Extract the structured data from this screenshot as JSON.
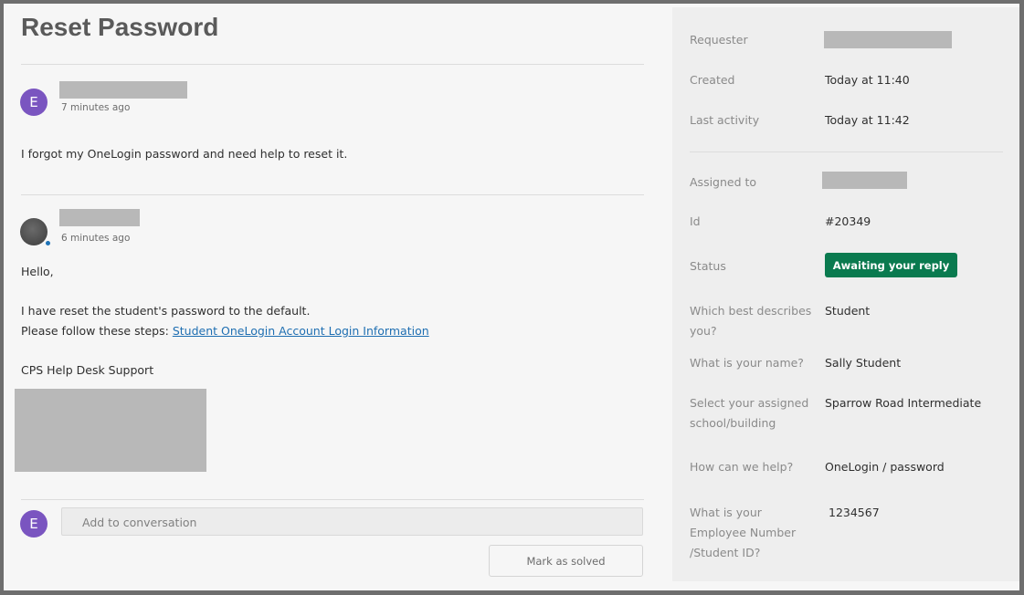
{
  "ticket": {
    "title": "Reset Password"
  },
  "conversation": [
    {
      "avatar_letter": "E",
      "time": "7 minutes ago",
      "lines": [
        "I forgot my OneLogin password and need help to reset it."
      ]
    },
    {
      "time": "6 minutes ago",
      "greeting": "Hello,",
      "line1": "I have reset the student's password to the default.",
      "line2_prefix": "Please follow these steps: ",
      "link_text": "Student OneLogin Account Login Information",
      "signature": "CPS Help Desk Support"
    }
  ],
  "composer": {
    "avatar_letter": "E",
    "placeholder": "Add to conversation",
    "solve_label": "Mark as solved"
  },
  "sidebar": {
    "requester_label": "Requester",
    "created_label": "Created",
    "created_value": "Today at 11:40",
    "last_activity_label": "Last activity",
    "last_activity_value": "Today at 11:42",
    "assigned_label": "Assigned to",
    "id_label": "Id",
    "id_value": "#20349",
    "status_label": "Status",
    "status_value": "Awaiting your reply",
    "status_color": "#0a7a4f",
    "describes_label_1": "Which best describes",
    "describes_label_2": "you?",
    "describes_value": "Student",
    "name_label": "What is your name?",
    "name_value": "Sally Student",
    "school_label_1": "Select your assigned",
    "school_label_2": "school/building",
    "school_value": "Sparrow Road Intermediate",
    "help_label": "How can we help?",
    "help_value": "OneLogin / password",
    "empno_label_1": "What is your",
    "empno_label_2": "Employee Number",
    "empno_label_3": "/Student ID?",
    "empno_value": "1234567"
  },
  "colors": {
    "accent_avatar": "#7a55c0",
    "link": "#1f6fb2"
  }
}
